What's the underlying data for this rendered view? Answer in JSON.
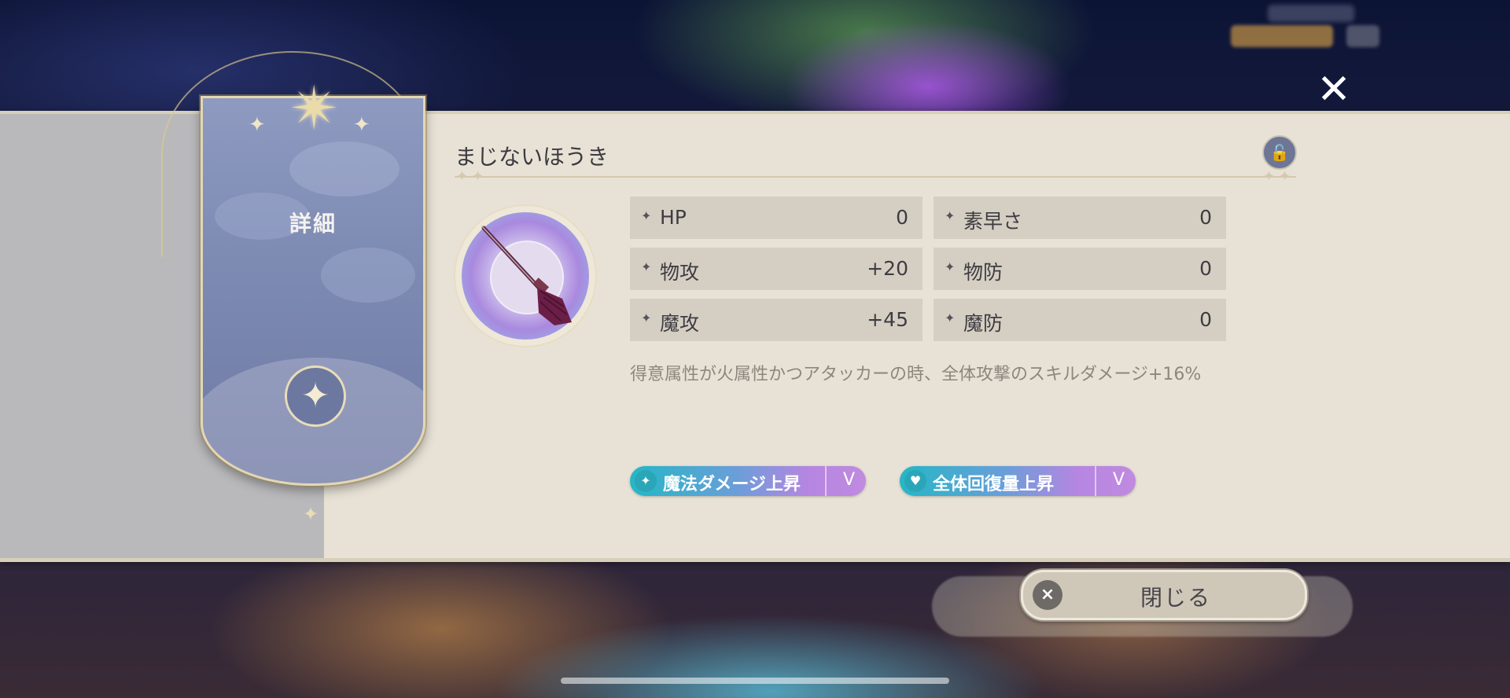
{
  "item": {
    "name": "まじないほうき",
    "description": "得意属性が火属性かつアタッカーの時、全体攻撃のスキルダメージ+16%"
  },
  "banner": {
    "label": "詳細"
  },
  "stats": {
    "left": [
      {
        "label": "HP",
        "value": "0"
      },
      {
        "label": "物攻",
        "value": "+20"
      },
      {
        "label": "魔攻",
        "value": "+45"
      }
    ],
    "right": [
      {
        "label": "素早さ",
        "value": "0"
      },
      {
        "label": "物防",
        "value": "0"
      },
      {
        "label": "魔防",
        "value": "0"
      }
    ]
  },
  "skills": [
    {
      "label": "魔法ダメージ上昇",
      "rank": "V",
      "icon": "wand-icon"
    },
    {
      "label": "全体回復量上昇",
      "rank": "V",
      "icon": "heart-icon"
    }
  ],
  "buttons": {
    "close_label": "閉じる",
    "close_icon": "×",
    "top_close_icon": "✕"
  },
  "icons": {
    "lock": "🔓",
    "stat_mark": "✦",
    "medal": "✦"
  },
  "colors": {
    "panel": "#e8e2d6",
    "banner": "#7e8bb3",
    "pill_start": "#24b7c6",
    "pill_end": "#c08ae0"
  }
}
